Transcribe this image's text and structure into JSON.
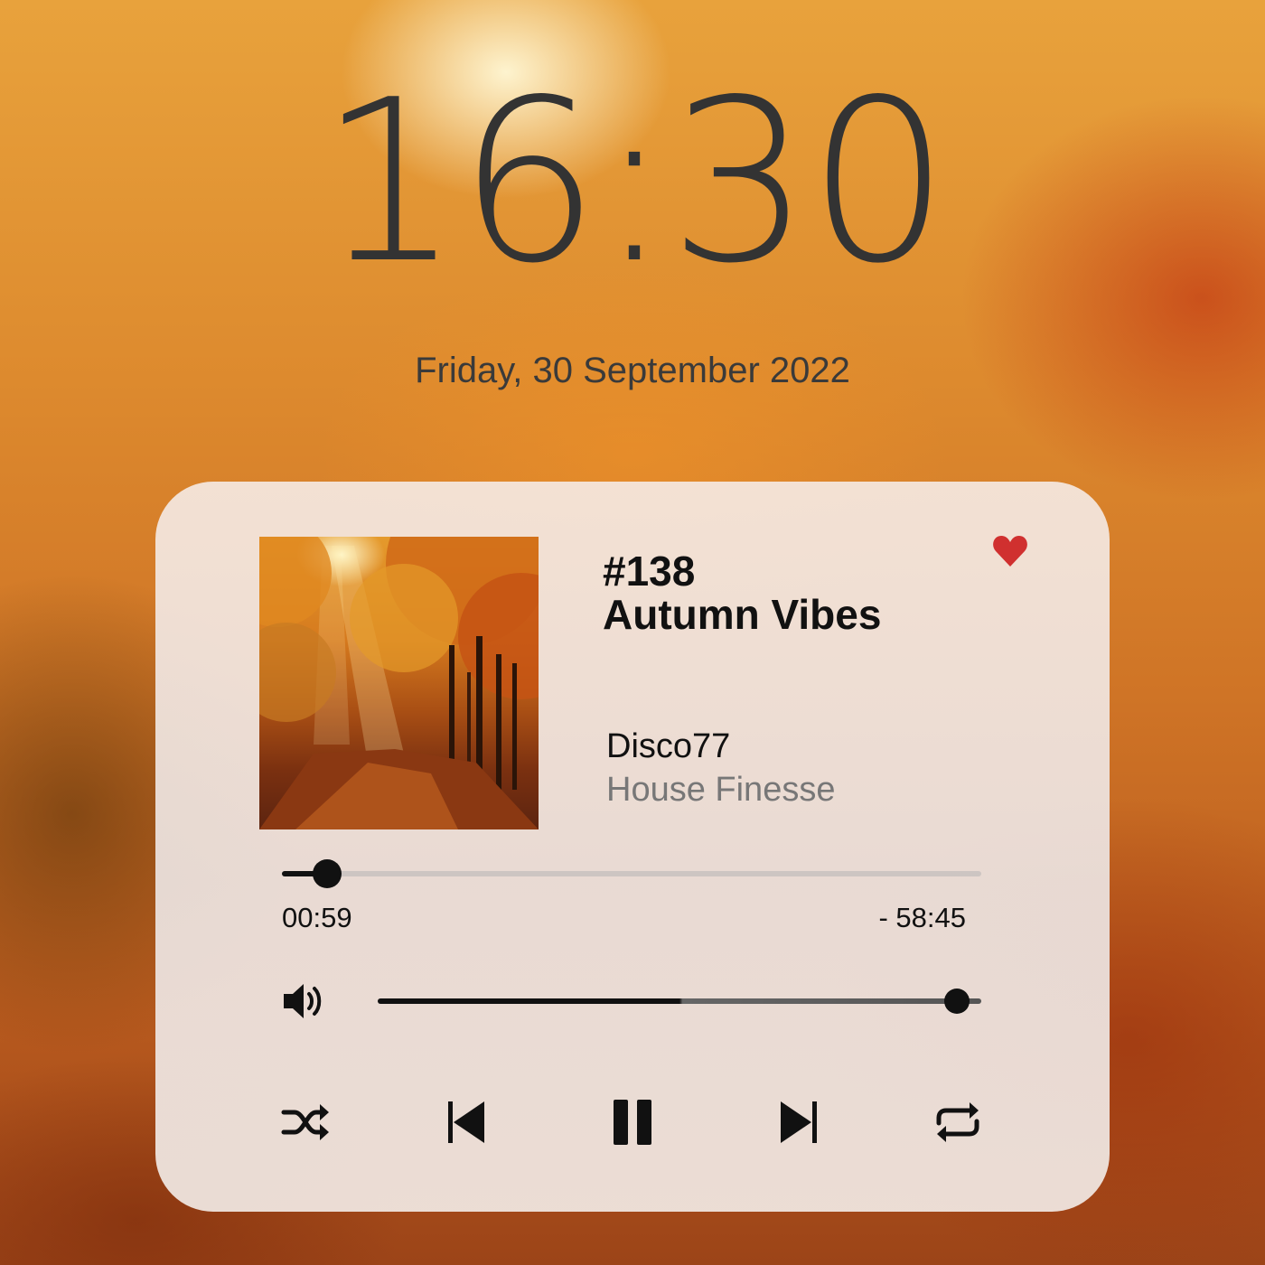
{
  "lockscreen": {
    "time": "16:30",
    "date": "Friday, 30 September 2022"
  },
  "player": {
    "episode": "#138",
    "title": "Autumn Vibes",
    "artist": "Disco77",
    "show": "House Finesse",
    "favorite": true,
    "favorite_color": "#d0302f",
    "elapsed": "00:59",
    "remaining": "- 58:45",
    "progress_fraction": 0.065,
    "volume_fraction": 0.96,
    "controls": [
      "shuffle-icon",
      "previous-icon",
      "pause-icon",
      "next-icon",
      "repeat-icon"
    ],
    "artwork": "autumn forest path photo"
  }
}
